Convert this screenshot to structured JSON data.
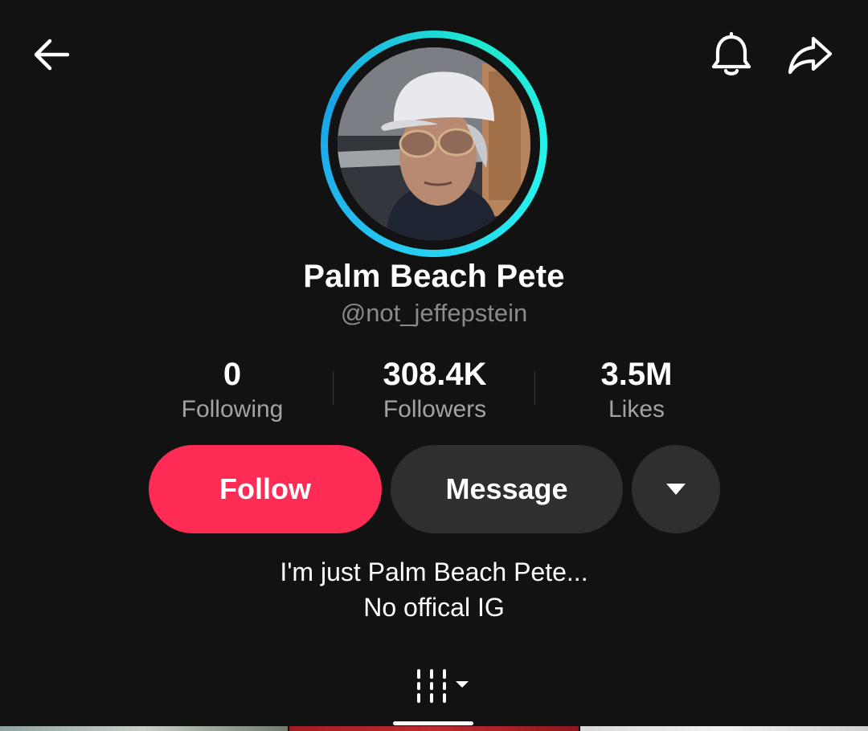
{
  "header": {
    "back_icon": "arrow-left-icon",
    "notifications_icon": "bell-icon",
    "share_icon": "share-arrow-icon"
  },
  "profile": {
    "display_name": "Palm Beach Pete",
    "handle": "@not_jeffepstein",
    "avatar_ring_colors": [
      "#25c8f0",
      "#25f4ee"
    ]
  },
  "stats": [
    {
      "value": "0",
      "label": "Following"
    },
    {
      "value": "308.4K",
      "label": "Followers"
    },
    {
      "value": "3.5M",
      "label": "Likes"
    }
  ],
  "actions": {
    "follow_label": "Follow",
    "message_label": "Message",
    "more_icon": "caret-down-icon",
    "follow_color": "#fe2c55",
    "secondary_color": "#2f2f2f"
  },
  "bio": {
    "line1": "I'm just Palm Beach Pete...",
    "line2": "No offical IG"
  },
  "tabs": {
    "active_icon": "grid-videos-icon",
    "dropdown_icon": "caret-down-icon"
  }
}
